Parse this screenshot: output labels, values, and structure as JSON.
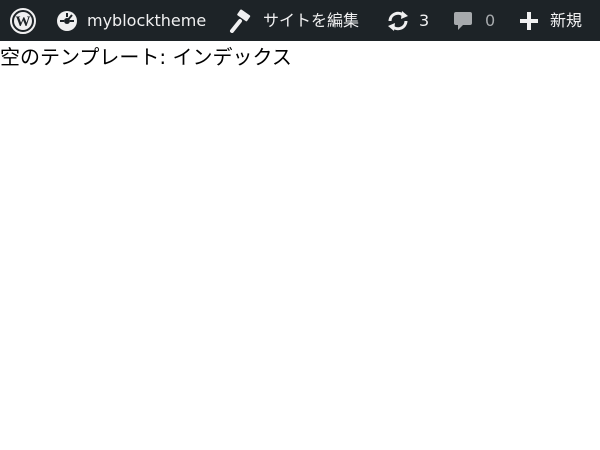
{
  "admin_bar": {
    "wp_logo_icon": "wordpress-logo-icon",
    "site_name": {
      "icon": "dashboard-gauge-icon",
      "label": "myblocktheme"
    },
    "site_editor": {
      "icon": "paintbrush-icon",
      "label": "サイトを編集"
    },
    "updates": {
      "icon": "update-arrows-icon",
      "count": "3"
    },
    "comments": {
      "icon": "comment-bubble-icon",
      "count": "0"
    },
    "new_content": {
      "icon": "plus-icon",
      "label": "新規"
    },
    "colors": {
      "background": "#1d2327",
      "text": "#f0f0f1",
      "muted": "#a7aaad"
    }
  },
  "content": {
    "text": "空のテンプレート: インデックス"
  }
}
